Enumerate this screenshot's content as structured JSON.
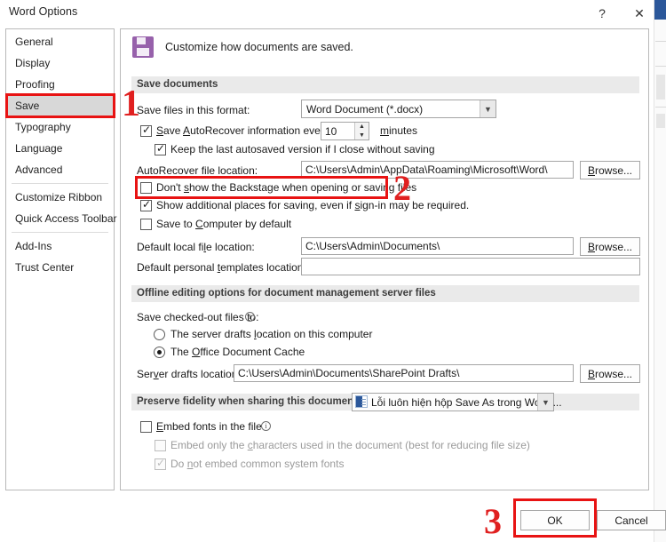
{
  "window": {
    "title": "Word Options",
    "help_label": "?",
    "close_label": "✕"
  },
  "sidebar": {
    "items": [
      {
        "label": "General",
        "selected": false
      },
      {
        "label": "Display",
        "selected": false
      },
      {
        "label": "Proofing",
        "selected": false
      },
      {
        "label": "Save",
        "selected": true
      },
      {
        "label": "Typography",
        "selected": false
      },
      {
        "label": "Language",
        "selected": false
      },
      {
        "label": "Advanced",
        "selected": false
      },
      {
        "label": "Customize Ribbon",
        "selected": false
      },
      {
        "label": "Quick Access Toolbar",
        "selected": false
      },
      {
        "label": "Add-Ins",
        "selected": false
      },
      {
        "label": "Trust Center",
        "selected": false
      }
    ]
  },
  "header": {
    "icon": "save-floppy-icon",
    "text": "Customize how documents are saved.",
    "icon_color": "#9761ab"
  },
  "save_documents": {
    "section_title": "Save documents",
    "format_label": "Save files in this format:",
    "format_value": "Word Document (*.docx)",
    "autorecover_label": "Save AutoRecover information every",
    "autorecover_minutes": "10",
    "minutes_label": "minutes",
    "autorecover_checked": true,
    "keep_last_label": "Keep the last autosaved version if I close without saving",
    "keep_last_checked": true,
    "autorecover_loc_label": "AutoRecover file location:",
    "autorecover_loc_value": "C:\\Users\\Admin\\AppData\\Roaming\\Microsoft\\Word\\",
    "browse_label": "Browse...",
    "backstage_label": "Don't show the Backstage when opening or saving files",
    "backstage_checked": false,
    "additional_places_label": "Show additional places for saving, even if sign-in may be required.",
    "additional_places_checked": true,
    "save_to_computer_label": "Save to Computer by default",
    "save_to_computer_checked": false,
    "default_local_label": "Default local file location:",
    "default_local_value": "C:\\Users\\Admin\\Documents\\",
    "default_templates_label": "Default personal templates location:",
    "default_templates_value": ""
  },
  "offline_editing": {
    "section_title": "Offline editing options for document management server files",
    "checked_out_label": "Save checked-out files to:",
    "info_icon": "ⓘ",
    "option_server_drafts": "The server drafts location on this computer",
    "option_office_cache": "The Office Document Cache",
    "selected_option": "office_cache",
    "server_drafts_label": "Server drafts location:",
    "server_drafts_value": "C:\\Users\\Admin\\Documents\\SharePoint Drafts\\",
    "browse_label": "Browse..."
  },
  "preserve_fidelity": {
    "section_title": "Preserve fidelity when sharing this document:",
    "document_value": "Lỗi luôn hiện hộp Save As trong Word....",
    "embed_fonts_label": "Embed fonts in the file",
    "embed_fonts_checked": false,
    "info_icon": "ⓘ",
    "embed_chars_label": "Embed only the characters used in the document (best for reducing file size)",
    "embed_chars_checked": false,
    "no_common_fonts_label": "Do not embed common system fonts",
    "no_common_fonts_checked": true
  },
  "footer": {
    "ok_label": "OK",
    "cancel_label": "Cancel"
  },
  "annotations": {
    "color": "#e02020",
    "marks": [
      {
        "number": "1",
        "target": "sidebar-item-save"
      },
      {
        "number": "2",
        "target": "dont-show-backstage-checkbox"
      },
      {
        "number": "3",
        "target": "ok-button"
      }
    ]
  }
}
